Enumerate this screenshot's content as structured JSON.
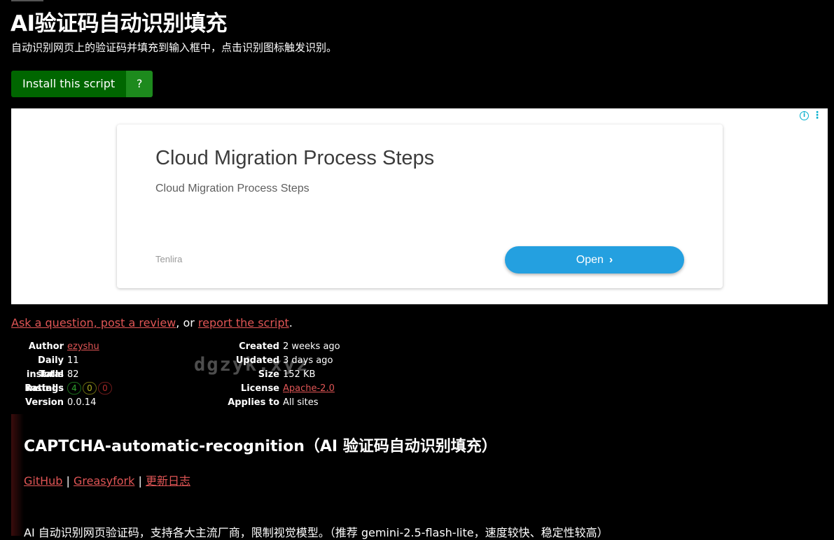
{
  "header": {
    "title": "AI验证码自动识别填充",
    "subtitle": "自动识别网页上的验证码并填充到输入框中，点击识别图标触发识别。"
  },
  "install": {
    "label": "Install this script",
    "help_label": "?"
  },
  "ad": {
    "headline": "Cloud Migration Process Steps",
    "description": "Cloud Migration Process Steps",
    "advertiser": "Tenlira",
    "button": "Open",
    "info_icon": "info-icon",
    "menu_icon": "kebab-menu-icon"
  },
  "feedback": {
    "ask": "Ask a question, post a review",
    "sep": ", or ",
    "report": "report the script",
    "end": "."
  },
  "meta": {
    "left": [
      {
        "label": "Author",
        "value": "ezyshu",
        "link": true
      },
      {
        "label": "Daily installs",
        "value": "11"
      },
      {
        "label": "Total installs",
        "value": "82"
      },
      {
        "label": "Ratings",
        "ratings": [
          "4",
          "0",
          "0"
        ]
      },
      {
        "label": "Version",
        "value": "0.0.14"
      }
    ],
    "right": [
      {
        "label": "Created",
        "value": "2 weeks ago"
      },
      {
        "label": "Updated",
        "value": "3 days ago"
      },
      {
        "label": "Size",
        "value": "152 KB"
      },
      {
        "label": "License",
        "value": "Apache-2.0",
        "link": true
      },
      {
        "label": "Applies to",
        "value": "All sites"
      }
    ]
  },
  "watermark": "dgzyk.xyz",
  "readme": {
    "title": "CAPTCHA-automatic-recognition（AI 验证码自动识别填充）",
    "links": [
      "GitHub",
      "Greasyfork",
      "更新日志"
    ],
    "link_sep": "|",
    "description": "AI 自动识别网页验证码，支持各大主流厂商，限制视觉模型。（推荐 gemini-2.5-flash-lite，速度较快、稳定性较高）"
  },
  "colors": {
    "link": "#e05555",
    "install": "#006600",
    "install_help": "#1d8a1d",
    "ad_button": "#24a0e0"
  }
}
